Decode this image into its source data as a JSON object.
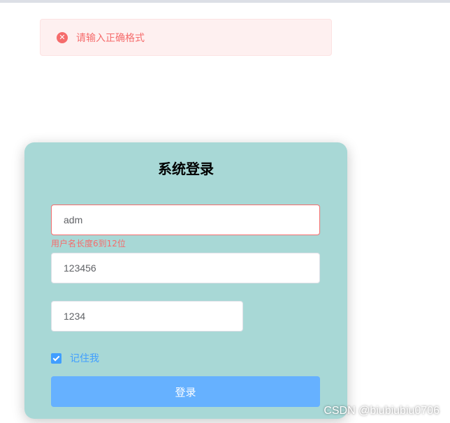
{
  "alert": {
    "icon": "error-circle-icon",
    "message": "请输入正确格式",
    "color": "#f56c6c"
  },
  "login_form": {
    "title": "系统登录",
    "username_value": "adm",
    "username_error": "用户名长度6到12位",
    "password_value": "123456",
    "captcha_value": "1234",
    "remember_label": "记住我",
    "remember_checked": true,
    "submit_label": "登录",
    "card_color": "#a8d8d6",
    "button_color": "#66b1ff"
  },
  "watermark": "CSDN @biubiubiu0706"
}
